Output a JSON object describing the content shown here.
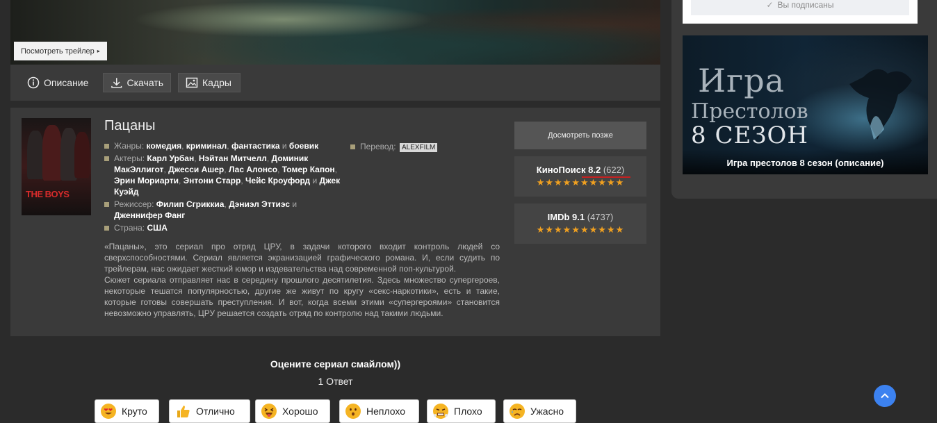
{
  "trailer": {
    "button_label": "Посмотреть трейлер"
  },
  "tabs": [
    {
      "label": "Описание",
      "icon": "info-icon"
    },
    {
      "label": "Скачать",
      "icon": "download-icon"
    },
    {
      "label": "Кадры",
      "icon": "image-icon"
    }
  ],
  "show": {
    "title": "Пацаны",
    "poster_text": "THE BOYS",
    "genres_label": "Жанры:",
    "genres": [
      "комедия",
      "криминал",
      "фантастика",
      "боевик"
    ],
    "actors_label": "Актеры:",
    "actors": [
      "Карл Урбан",
      "Нэйтан Митчелл",
      "Доминик МакЭллигот",
      "Джесси Ашер",
      "Лас Алонсо",
      "Томер Капон",
      "Эрин Мориарти",
      "Энтони Старр",
      "Чейс Кроуфорд",
      "Джек Куэйд"
    ],
    "director_label": "Режиссер:",
    "directors": [
      "Филип Сгриккиа",
      "Дэниэл Эттиэс",
      "Дженнифер Фанг"
    ],
    "country_label": "Страна:",
    "country": "США",
    "translation_label": "Перевод:",
    "translation": "ALEXFILM",
    "description_p1": "«Пацаны», это сериал про отряд ЦРУ, в задачи которого входит контроль людей со сверхспособностями. Сериал является экранизацией графического романа. И, если судить по трейлерам, нас ожидает жесткий юмор и издевательства над современной поп-культурой.",
    "description_p2": "Сюжет сериала отправляет нас в середину прошлого десятилетия. Здесь множество супергероев, некоторые тешатся популярностью, другие же живут по кругу «секс-наркотики», есть и такие, которые готовы совершать преступления. И вот, когда всеми этими «супергероями» становится невозможно управлять, ЦРУ решается создать отряд по контролю над такими людьми."
  },
  "actions": {
    "watch_later": "Досмотреть позже"
  },
  "ratings": {
    "kinopoisk": {
      "label": "КиноПоиск 8.2",
      "count": "(622)",
      "stars": "★★★★★★★★★★"
    },
    "imdb": {
      "label": "IMDb 9.1",
      "count": "(4737)",
      "stars": "★★★★★★★★★★"
    }
  },
  "vote": {
    "title": "Оцените сериал смайлом))",
    "count": "1 Ответ",
    "options": [
      "Круто",
      "Отлично",
      "Хорошо",
      "Неплохо",
      "Плохо",
      "Ужасно"
    ]
  },
  "sidebar": {
    "subscribed": "Вы подписаны",
    "promo_line1": "Игра",
    "promo_line2": "Престолов",
    "promo_line3": "8 СЕЗОН",
    "promo_caption": "Игра престолов 8 сезон (описание)"
  },
  "colors": {
    "accent_blue": "#3c82f0",
    "star": "#f0a020",
    "kp_underline": "#c62020"
  }
}
